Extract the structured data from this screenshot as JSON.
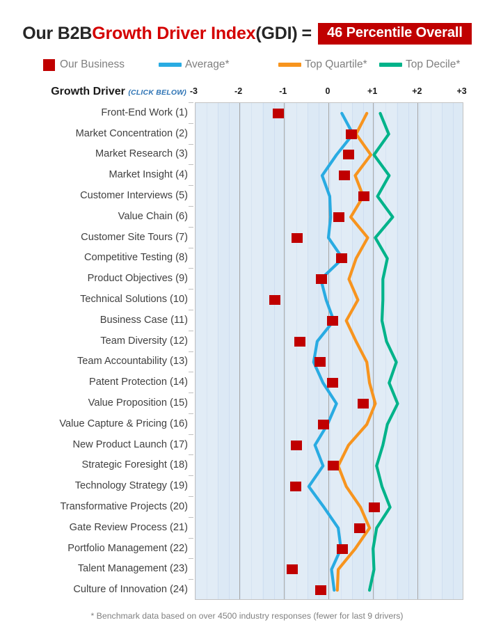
{
  "title": {
    "part1": "Our B2B ",
    "part2_red": "Growth Driver Index",
    "part3": " (GDI)",
    "equals": "=",
    "badge": "46 Percentile Overall",
    "badge_color": "#c00000",
    "red_color": "#d40000"
  },
  "legend": {
    "items": [
      {
        "label": "Our Business",
        "color": "#c00000",
        "marker": "square"
      },
      {
        "label": "Average*",
        "color": "#29ABE2",
        "marker": "line"
      },
      {
        "label": "Top Quartile*",
        "color": "#F7941E",
        "marker": "line"
      },
      {
        "label": "Top Decile*",
        "color": "#00B38A",
        "marker": "line"
      }
    ]
  },
  "axis_header": {
    "row_header": "Growth Driver",
    "row_header_hint": "(CLICK BELOW)",
    "ticks": [
      "-3",
      "-2",
      "-1",
      "0",
      "+1",
      "+2",
      "+3"
    ]
  },
  "footnote": "* Benchmark data based on over 4500 industry responses (fewer for last 9 drivers)",
  "chart_data": {
    "type": "line",
    "title": "Our B2B Growth Driver Index (GDI) = 46 Percentile Overall",
    "orientation": "horizontal-categories-vertical-axis",
    "xlabel": "",
    "ylabel": "Growth Driver",
    "xlim": [
      -3,
      3
    ],
    "xticks": [
      -3,
      -2,
      -1,
      0,
      1,
      2,
      3
    ],
    "grid": true,
    "legend_position": "top",
    "categories": [
      "Front-End Work (1)",
      "Market Concentration (2)",
      "Market Research (3)",
      "Market Insight (4)",
      "Customer Interviews (5)",
      "Value Chain (6)",
      "Customer Site Tours (7)",
      "Competitive Testing (8)",
      "Product Objectives (9)",
      "Technical Solutions (10)",
      "Business Case (11)",
      "Team Diversity (12)",
      "Team Accountability (13)",
      "Patent Protection (14)",
      "Value Proposition (15)",
      "Value Capture & Pricing (16)",
      "New Product Launch (17)",
      "Strategic Foresight (18)",
      "Technology Strategy (19)",
      "Transformative Projects (20)",
      "Gate Review Process (21)",
      "Portfolio Management (22)",
      "Talent Management (23)",
      "Culture of Innovation (24)"
    ],
    "series": [
      {
        "name": "Our Business",
        "type": "scatter",
        "color": "#c00000",
        "values": [
          -1.12,
          0.51,
          0.45,
          0.36,
          0.79,
          0.23,
          -0.7,
          0.3,
          -0.16,
          -1.2,
          0.09,
          -0.64,
          -0.19,
          0.09,
          0.78,
          -0.11,
          -0.72,
          0.11,
          -0.73,
          1.03,
          0.7,
          0.31,
          -0.81,
          -0.17
        ]
      },
      {
        "name": "Average*",
        "type": "line",
        "color": "#29ABE2",
        "values": [
          0.3,
          0.55,
          0.18,
          -0.14,
          0.03,
          0.05,
          0.0,
          0.32,
          -0.17,
          -0.05,
          0.12,
          -0.25,
          -0.33,
          -0.12,
          0.18,
          -0.02,
          -0.3,
          -0.12,
          -0.44,
          -0.1,
          0.22,
          0.28,
          0.07,
          0.13
        ]
      },
      {
        "name": "Top Quartile*",
        "type": "line",
        "color": "#F7941E",
        "values": [
          0.86,
          0.62,
          0.95,
          0.6,
          0.78,
          0.5,
          0.88,
          0.62,
          0.46,
          0.66,
          0.4,
          0.62,
          0.86,
          0.92,
          1.05,
          0.86,
          0.45,
          0.22,
          0.4,
          0.72,
          0.92,
          0.6,
          0.22,
          0.2
        ]
      },
      {
        "name": "Top Decile*",
        "type": "line",
        "color": "#00B38A",
        "values": [
          1.16,
          1.35,
          1.02,
          1.36,
          1.1,
          1.44,
          1.05,
          1.32,
          1.22,
          1.22,
          1.2,
          1.3,
          1.52,
          1.36,
          1.55,
          1.32,
          1.22,
          1.08,
          1.2,
          1.38,
          1.08,
          1.0,
          1.02,
          0.92
        ]
      }
    ]
  }
}
